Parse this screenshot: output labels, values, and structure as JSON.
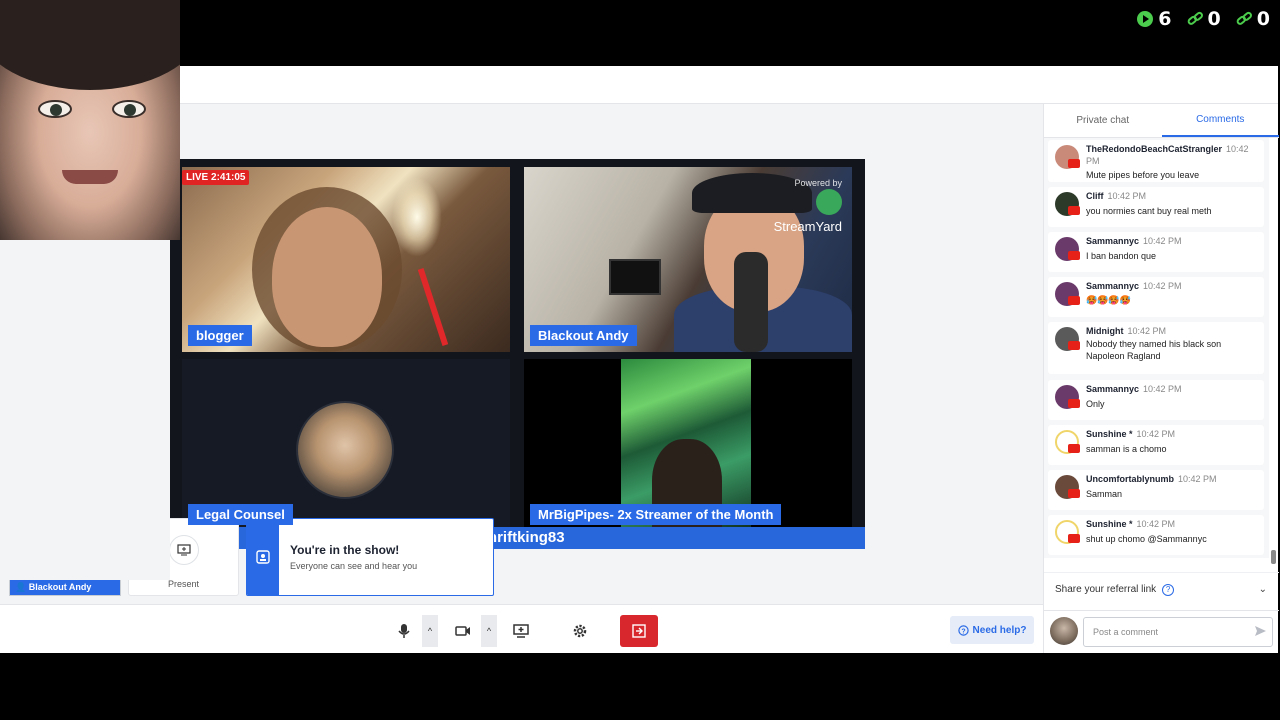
{
  "overlay_counters": [
    {
      "icon": "play-icon",
      "value": "6",
      "color": "#4ccc4c"
    },
    {
      "icon": "link-icon",
      "value": "0",
      "color": "#4ccc4c"
    },
    {
      "icon": "link-icon",
      "value": "0",
      "color": "#4ccc4c"
    }
  ],
  "stage": {
    "live_badge": "LIVE 2:41:05",
    "streamyard_powered": "Powered by",
    "streamyard_brand": "StreamYard",
    "tiles": [
      {
        "name": "blogger"
      },
      {
        "name": "Blackout Andy"
      },
      {
        "name": "Legal Counsel"
      },
      {
        "name": "MrBigPipes- 2x Streamer of the Month"
      }
    ],
    "footer_banner": "$Thriftking83"
  },
  "self_cam": {
    "name": "Blackout Andy"
  },
  "present": {
    "label": "Present"
  },
  "toast": {
    "title": "You're in the show!",
    "subtitle": "Everyone can see and hear you"
  },
  "toolbar": {
    "need_help": "Need help?"
  },
  "panel": {
    "tabs": [
      {
        "label": "Private chat",
        "active": false
      },
      {
        "label": "Comments",
        "active": true
      }
    ],
    "comments": [
      {
        "author": "TheRedondoBeachCatStrangler",
        "time": "10:42",
        "time_wrap": "PM",
        "text": "Mute pipes before you leave",
        "avatar": "#c98a7a"
      },
      {
        "author": "Cliff",
        "time": "10:42 PM",
        "text": "you normies cant buy real meth",
        "avatar": "#2d3a2a"
      },
      {
        "author": "Sammannyc",
        "time": "10:42 PM",
        "text": "I ban bandon que",
        "avatar": "#6a3a6a"
      },
      {
        "author": "Sammannyc",
        "time": "10:42 PM",
        "text": "🥵🥵🥵🥵",
        "avatar": "#6a3a6a"
      },
      {
        "author": "Midnight",
        "time": "10:42 PM",
        "text": "Nobody they named his black son Napoleon Ragland",
        "avatar": "#5a5a5a"
      },
      {
        "author": "Sammannyc",
        "time": "10:42 PM",
        "text": "Only",
        "avatar": "#6a3a6a"
      },
      {
        "author": "Sunshine *",
        "time": "10:42 PM",
        "text": "samman is a chomo",
        "avatar": "#f4e6a6"
      },
      {
        "author": "Uncomfortablynumb",
        "time": "10:42 PM",
        "text": "Samman",
        "avatar": "#6a4a3a"
      },
      {
        "author": "Sunshine *",
        "time": "10:42 PM",
        "text": "shut up chomo @Sammannyc",
        "avatar": "#f4e6a6"
      }
    ],
    "referral": "Share your referral link",
    "post_placeholder": "Post a comment"
  },
  "colors": {
    "accent": "#2a6ae6",
    "live": "#e02424",
    "leave": "#d9272e",
    "youtube": "#e62117"
  }
}
